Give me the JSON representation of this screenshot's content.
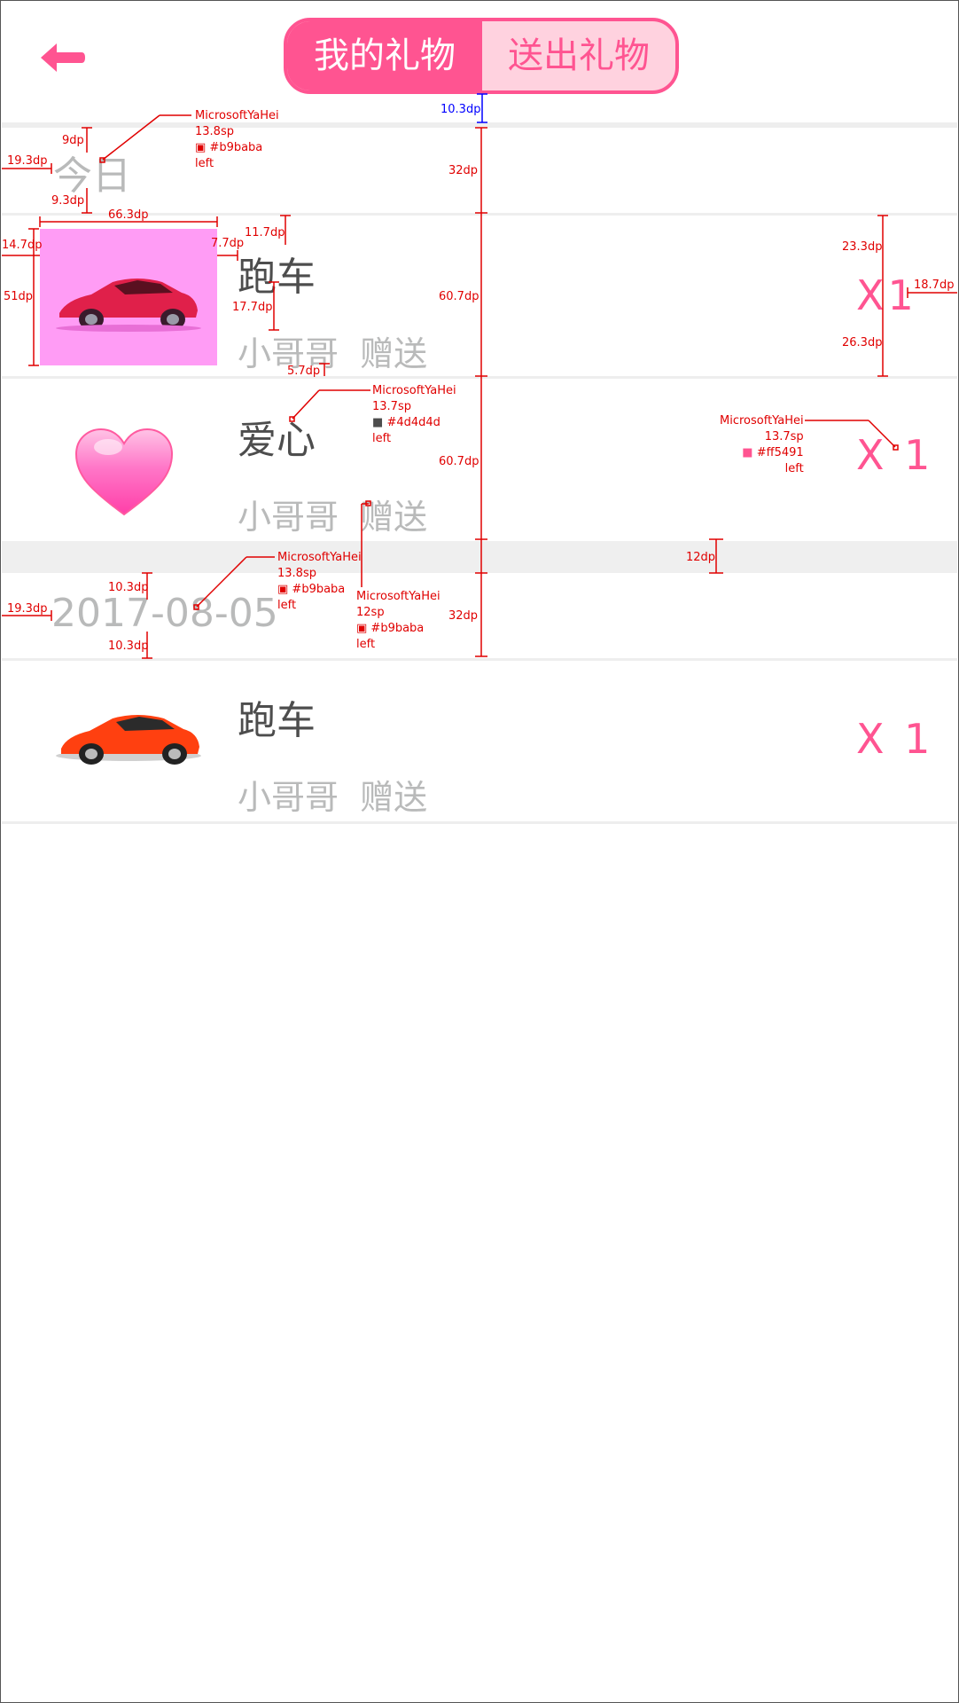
{
  "header": {
    "tabs": [
      {
        "label": "我的礼物",
        "active": true
      },
      {
        "label": "送出礼物",
        "active": false
      }
    ]
  },
  "colors": {
    "accent": "#ff5491",
    "date_gray": "#b9baba",
    "title_dark": "#4d4d4d"
  },
  "groups": [
    {
      "date": "今日",
      "items": [
        {
          "name": "跑车",
          "from": "小哥哥",
          "action": "赠送",
          "qty": "X1",
          "icon": "sports-car-icon"
        },
        {
          "name": "爱心",
          "from": "小哥哥",
          "action": "赠送",
          "qty": "X 1",
          "icon": "heart-icon"
        }
      ]
    },
    {
      "date": "2017-08-05",
      "items": [
        {
          "name": "跑车",
          "from": "小哥哥",
          "action": "赠送",
          "qty": "X 1",
          "icon": "sports-car-icon"
        }
      ]
    }
  ],
  "annotations": {
    "top_gap": "10.3dp",
    "row32a": "32dp",
    "row607a": "60.7dp",
    "row607b": "60.7dp",
    "gap12": "12dp",
    "row32b": "32dp",
    "d9": "9dp",
    "d193a": "19.3dp",
    "d93": "9.3dp",
    "font_date": {
      "font": "MicrosoftYaHei",
      "size": "13.8sp",
      "color": "#b9baba",
      "align": "left"
    },
    "w663": "66.3dp",
    "d147": "14.7dp",
    "d51": "51dp",
    "d77": "7.7dp",
    "d117": "11.7dp",
    "d177": "17.7dp",
    "d57": "5.7dp",
    "d233": "23.3dp",
    "d263": "26.3dp",
    "d187": "18.7dp",
    "font_title": {
      "font": "MicrosoftYaHei",
      "size": "13.7sp",
      "color": "#4d4d4d",
      "align": "left"
    },
    "font_qty": {
      "font": "MicrosoftYaHei",
      "size": "13.7sp",
      "color": "#ff5491",
      "align": "left"
    },
    "d103a": "10.3dp",
    "d193b": "19.3dp",
    "d103b": "10.3dp",
    "font_date2": {
      "font": "MicrosoftYaHei",
      "size": "13.8sp",
      "color": "#b9baba",
      "align": "left"
    },
    "font_sub": {
      "font": "MicrosoftYaHei",
      "size": "12sp",
      "color": "#b9baba",
      "align": "left"
    }
  }
}
